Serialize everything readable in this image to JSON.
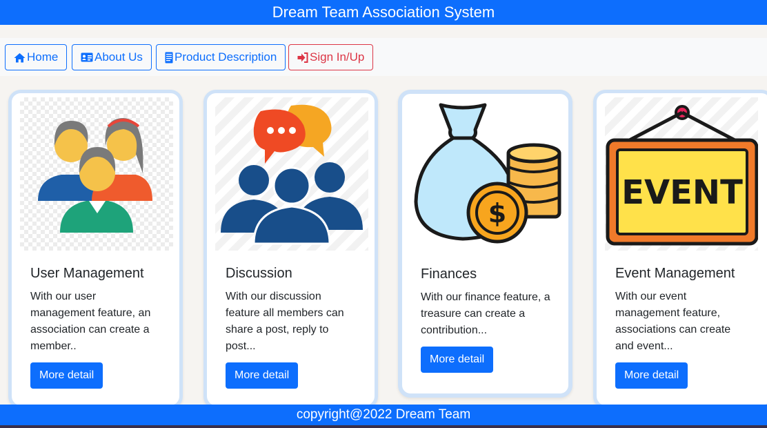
{
  "header": {
    "title": "Dream Team Association System"
  },
  "nav": {
    "home": {
      "label": "Home",
      "icon": "home-icon"
    },
    "about": {
      "label": "About Us",
      "icon": "id-card-icon"
    },
    "product": {
      "label": "Product Description",
      "icon": "document-icon"
    },
    "signin": {
      "label": "Sign In/Up",
      "icon": "sign-in-icon"
    }
  },
  "cards": [
    {
      "title": "User Management",
      "text": "With our user management feature, an association can create a member..",
      "button": "More detail",
      "icon": "users-group-icon"
    },
    {
      "title": "Discussion",
      "text": "With our discussion feature all members can share a post, reply to post...",
      "button": "More detail",
      "icon": "discussion-icon"
    },
    {
      "title": "Finances",
      "text": "With our finance feature, a treasure can create a contribution...",
      "button": "More detail",
      "icon": "money-bag-icon"
    },
    {
      "title": "Event Management",
      "text": "With our event management feature, associations can create and event...",
      "button": "More detail",
      "icon": "event-sign-icon"
    }
  ],
  "footer": {
    "text": "copyright@2022 Dream Team"
  },
  "colors": {
    "primary": "#0d6efd",
    "danger": "#dc3545",
    "card_border": "#cfe2f8"
  }
}
